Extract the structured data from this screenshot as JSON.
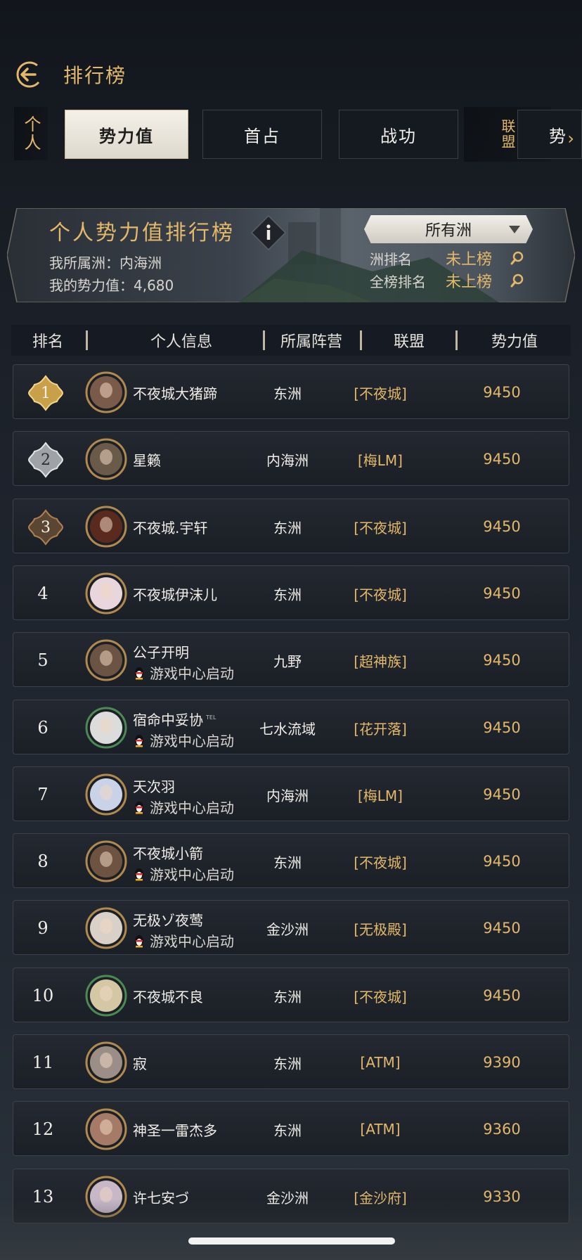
{
  "header": {
    "title": "排行榜"
  },
  "tabs": {
    "personal": "个人",
    "items": [
      "势力值",
      "首占",
      "战功"
    ],
    "alliance": "联盟",
    "partial": "势"
  },
  "banner": {
    "title": "个人势力值排行榜",
    "my_continent": "我所属洲：内海洲",
    "my_power": "我的势力值：4,680",
    "select": "所有洲",
    "continent_rank_label": "洲排名",
    "continent_rank_value": "未上榜",
    "global_rank_label": "全榜排名",
    "global_rank_value": "未上榜"
  },
  "table": {
    "headers": [
      "排名",
      "个人信息",
      "所属阵营",
      "联盟",
      "势力值"
    ],
    "rows": [
      {
        "rank": "1",
        "name": "不夜城大猪蹄",
        "sub": "",
        "camp": "东洲",
        "alliance": "[不夜城]",
        "power": "9450"
      },
      {
        "rank": "2",
        "name": "星籁",
        "sub": "",
        "camp": "内海洲",
        "alliance": "[梅LM]",
        "power": "9450"
      },
      {
        "rank": "3",
        "name": "不夜城.宇轩",
        "sub": "",
        "camp": "东洲",
        "alliance": "[不夜城]",
        "power": "9450"
      },
      {
        "rank": "4",
        "name": "不夜城伊沫儿",
        "sub": "",
        "camp": "东洲",
        "alliance": "[不夜城]",
        "power": "9450"
      },
      {
        "rank": "5",
        "name": "公子开明",
        "sub": "游戏中心启动",
        "camp": "九野",
        "alliance": "[超神族]",
        "power": "9450"
      },
      {
        "rank": "6",
        "name": "宿命中妥协",
        "sub": "游戏中心启动",
        "camp": "七水流域",
        "alliance": "[花开落]",
        "power": "9450",
        "badge": "TEL"
      },
      {
        "rank": "7",
        "name": "天次羽",
        "sub": "游戏中心启动",
        "camp": "内海洲",
        "alliance": "[梅LM]",
        "power": "9450"
      },
      {
        "rank": "8",
        "name": "不夜城小箭",
        "sub": "游戏中心启动",
        "camp": "东洲",
        "alliance": "[不夜城]",
        "power": "9450"
      },
      {
        "rank": "9",
        "name": "无极ゾ夜莺",
        "sub": "游戏中心启动",
        "camp": "金沙洲",
        "alliance": "[无极殿]",
        "power": "9450"
      },
      {
        "rank": "10",
        "name": "不夜城不良",
        "sub": "",
        "camp": "东洲",
        "alliance": "[不夜城]",
        "power": "9450"
      },
      {
        "rank": "11",
        "name": "寂",
        "sub": "",
        "camp": "东洲",
        "alliance": "[ATM]",
        "power": "9390"
      },
      {
        "rank": "12",
        "name": "神圣一雷杰多",
        "sub": "",
        "camp": "东洲",
        "alliance": "[ATM]",
        "power": "9360"
      },
      {
        "rank": "13",
        "name": "许七安づ",
        "sub": "",
        "camp": "金沙洲",
        "alliance": "[金沙府]",
        "power": "9330"
      }
    ]
  },
  "colors": {
    "gold": "#e3b86a",
    "silver": "#c9c9c9",
    "bronze": "#a0763e"
  },
  "icons": {
    "back": "back-arrow-icon",
    "info": "info-icon",
    "search": "magnifier-icon",
    "penguin": "qq-penguin-icon"
  }
}
